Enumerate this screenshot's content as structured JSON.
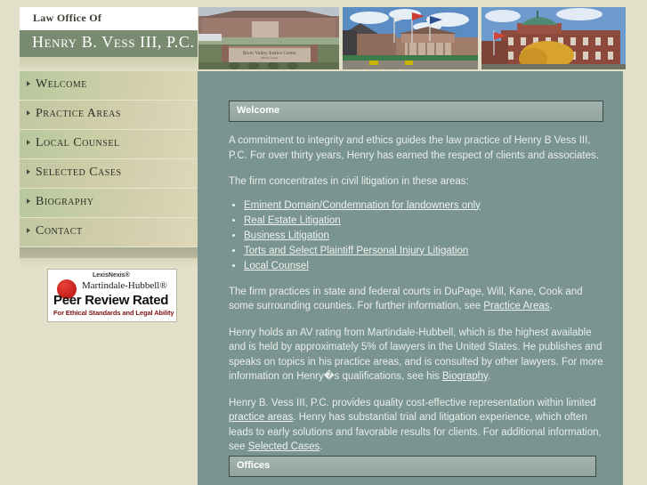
{
  "header": {
    "firm_pre": "Law Office Of",
    "firm_name": "Henry B. Vess III, P.C.",
    "photos": [
      {
        "name": "river-valley-justice-center",
        "caption": "River Valley Justice Center"
      },
      {
        "name": "county-courthouse-with-flags",
        "caption": ""
      },
      {
        "name": "historic-brick-courthouse",
        "caption": ""
      }
    ]
  },
  "sidebar": {
    "items": [
      {
        "label": "Welcome"
      },
      {
        "label": "Practice Areas"
      },
      {
        "label": "Local Counsel"
      },
      {
        "label": "Selected Cases"
      },
      {
        "label": "Biography"
      },
      {
        "label": "Contact"
      }
    ],
    "badge": {
      "lexisnexis": "LexisNexis®",
      "martindale": "Martindale-Hubbell®",
      "rating": "Peer Review Rated",
      "subtitle": "For Ethical Standards and Legal Ability"
    }
  },
  "main": {
    "welcome_heading": "Welcome",
    "p1": "A commitment to integrity and ethics guides the law practice of Henry B Vess III, P.C.  For over thirty years, Henry has earned the respect of clients and associates.",
    "p2": "The firm concentrates in civil litigation in these areas:",
    "practice_links": [
      "Eminent Domain/Condemnation for landowners only",
      "Real Estate Litigation",
      "Business Litigation",
      "Torts and Select Plaintiff Personal Injury Litigation",
      "Local Counsel"
    ],
    "p3_before": "The firm practices in state and federal courts in DuPage, Will, Kane, Cook and some surrounding counties. For further information, see ",
    "p3_link": "Practice Areas",
    "p3_after": ".",
    "p4_before": "Henry holds an AV rating from Martindale-Hubbell, which is the highest available and is held by approximately 5% of lawyers in the United States.  He publishes and speaks on topics in his practice areas, and is consulted by other lawyers.  For more information on Henry�s qualifications, see his ",
    "p4_link": "Biography",
    "p4_after": ".",
    "p5_before": "Henry B. Vess III, P.C. provides quality cost-effective representation within limited ",
    "p5_link1": "practice areas",
    "p5_mid": ".  Henry has substantial trial and litigation experience, which often leads to early solutions and favorable results for clients.  For additional information, see ",
    "p5_link2": "Selected Cases",
    "p5_after": ".",
    "offices_heading": "Offices"
  },
  "colors": {
    "page_bg": "#e2e0c8",
    "content_bg": "#7a9490",
    "logo_band": "#798c72",
    "section_bar": "#93a5a1"
  }
}
